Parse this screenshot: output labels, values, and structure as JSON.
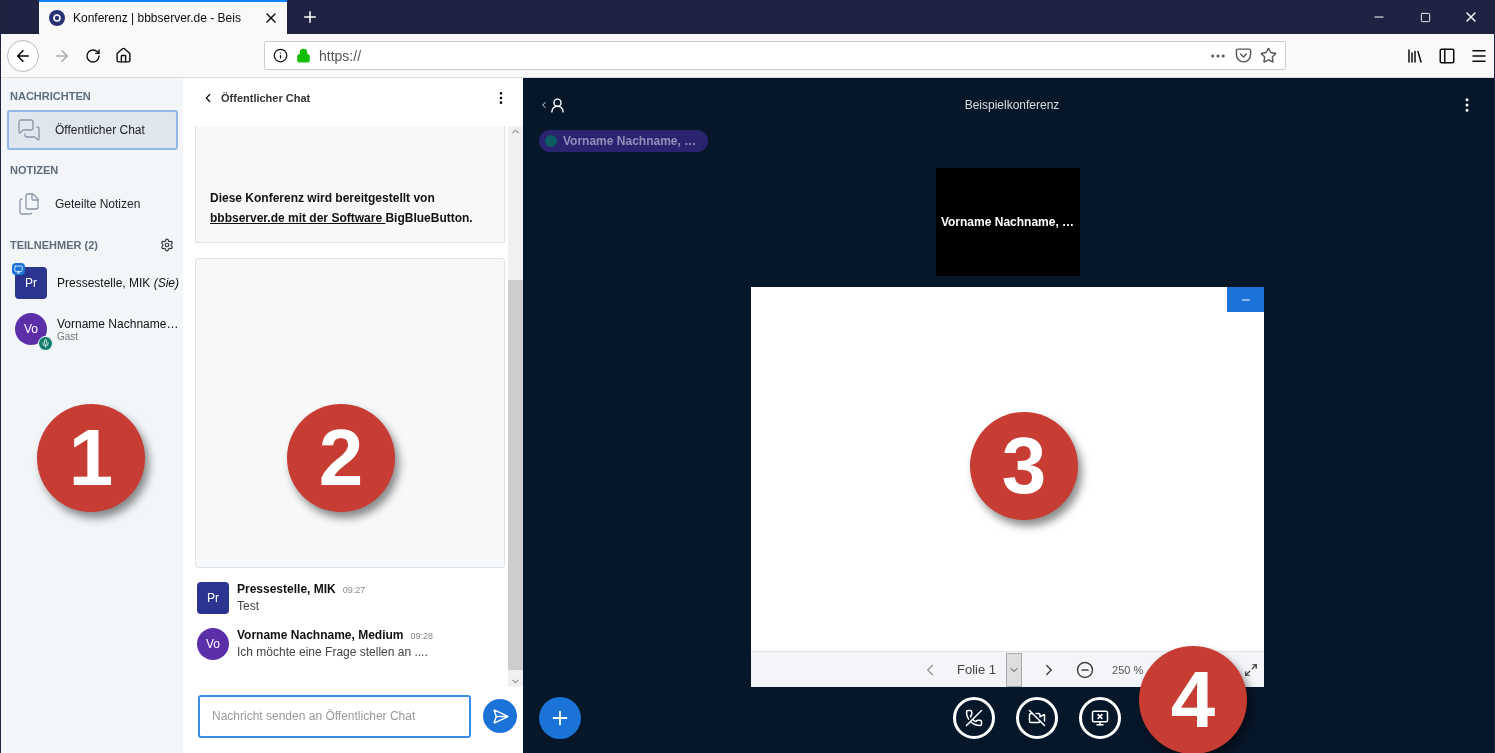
{
  "browser": {
    "tab_title": "Konferenz | bbbserver.de - Beis",
    "url": "https://"
  },
  "sidebar": {
    "messages_heading": "NACHRICHTEN",
    "chat_items": [
      {
        "label": "Öffentlicher Chat",
        "selected": true
      }
    ],
    "notes_heading": "NOTIZEN",
    "note_items": [
      {
        "label": "Geteilte Notizen"
      }
    ],
    "participants_heading": "TEILNEHMER (2)",
    "participants": [
      {
        "initials": "Pr",
        "name": "Pressestelle, MIK *(Sie)*",
        "color": "#2b3590",
        "kind": "presenter"
      },
      {
        "initials": "Vo",
        "name": "Vorname Nachname…",
        "role": "Gast",
        "color": "#5a2fa8",
        "kind": "listener"
      }
    ]
  },
  "chat": {
    "title": "Öffentlicher Chat",
    "welcome": {
      "before": "Diese Konferenz wird bereitgestellt von ",
      "link": "bbbserver.de mit der Software ",
      "after": "BigBlueButton."
    },
    "messages": [
      {
        "initials": "Pr",
        "name": "Pressestelle, MIK",
        "time": "09:27",
        "text": "Test",
        "color": "#2b3590",
        "kind": "square"
      },
      {
        "initials": "Vo",
        "name": "Vorname Nachname, Medium",
        "time": "09:28",
        "text": "Ich möchte eine Frage stellen an ....",
        "color": "#5a2fa8",
        "kind": "circle"
      }
    ],
    "input": {
      "placeholder": "Nachricht senden an Öffentlicher Chat"
    }
  },
  "main": {
    "title": "Beispielkonferenz",
    "talking": "Vorname Nachname, …",
    "webcam_name": "Vorname Nachname, …",
    "slide": {
      "label": "Folie 1",
      "zoom": "250 %"
    }
  },
  "callouts": [
    "1",
    "2",
    "3",
    "4"
  ]
}
